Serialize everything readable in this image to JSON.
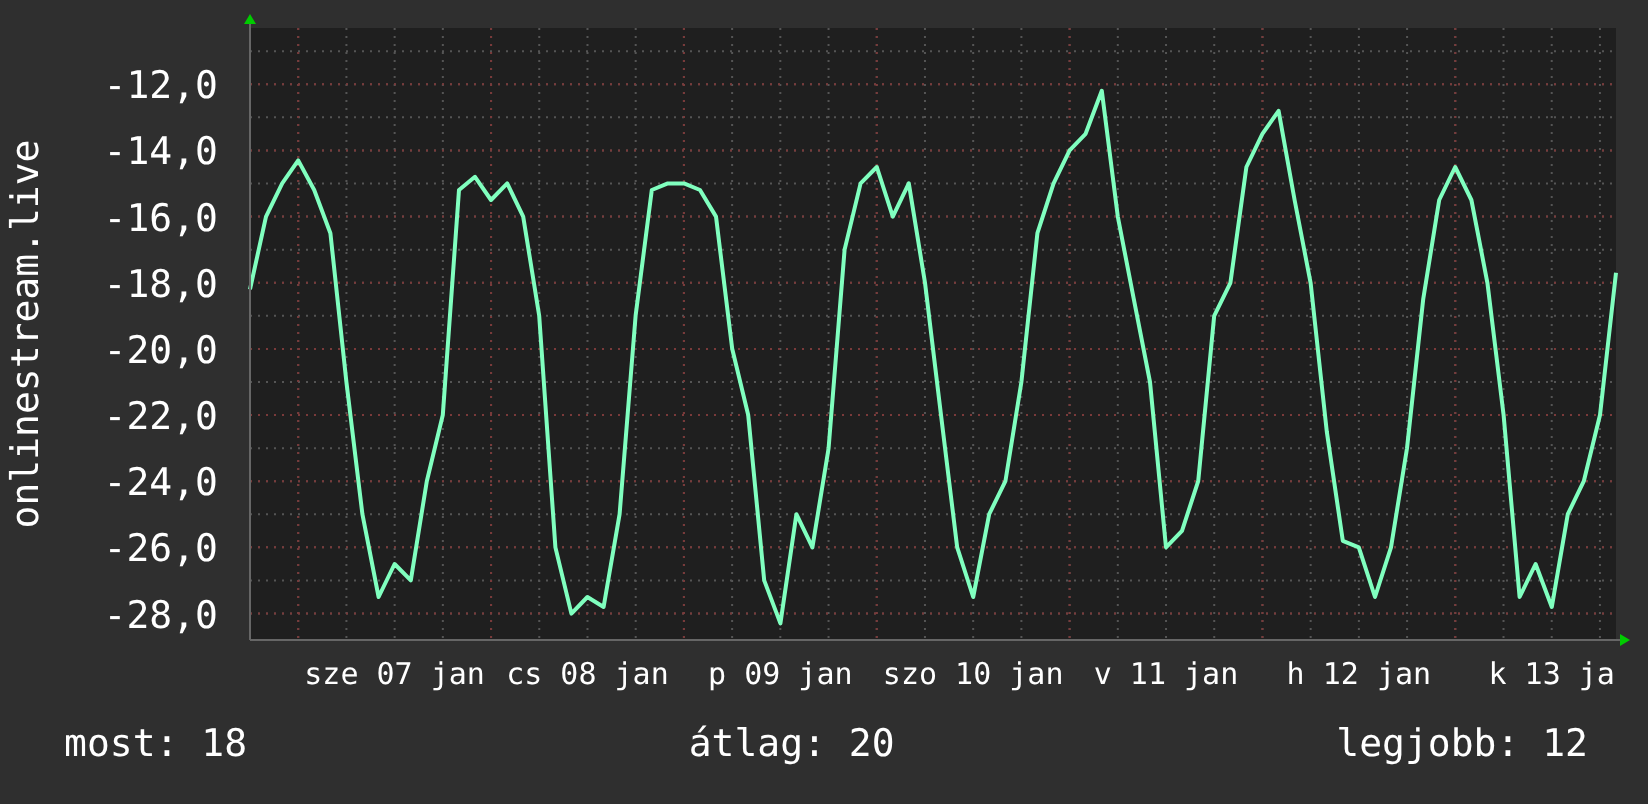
{
  "chart": {
    "chart_data": {
      "type": "line",
      "ylabel": "onlinestream.live",
      "categories": [
        null,
        null,
        null,
        null,
        null,
        null,
        null,
        null,
        null,
        "sze 07 jan",
        null,
        null,
        null,
        null,
        null,
        null,
        null,
        null,
        null,
        null,
        null,
        "cs 08 jan",
        null,
        null,
        null,
        null,
        null,
        null,
        null,
        null,
        null,
        null,
        null,
        "p 09 jan",
        null,
        null,
        null,
        null,
        null,
        null,
        null,
        null,
        null,
        null,
        null,
        "szo 10 jan",
        null,
        null,
        null,
        null,
        null,
        null,
        null,
        null,
        null,
        null,
        null,
        "v 11 jan",
        null,
        null,
        null,
        null,
        null,
        null,
        null,
        null,
        null,
        null,
        null,
        "h 12 jan",
        null,
        null,
        null,
        null,
        null,
        null,
        null,
        null,
        null,
        null,
        null,
        "k 13 ja",
        null,
        null,
        null,
        null
      ],
      "series": [
        {
          "color": "#80ffbf",
          "values": [
            -18.2,
            -16,
            -15,
            -14.3,
            -15.2,
            -16.5,
            -21,
            -25,
            -27.5,
            -26.5,
            -27,
            -24,
            -22,
            -15.2,
            -14.8,
            -15.5,
            -15,
            -16,
            -19,
            -26,
            -28,
            -27.5,
            -27.8,
            -25,
            -19,
            -15.2,
            -15,
            -15,
            -15.2,
            -16,
            -20,
            -22,
            -27,
            -28.3,
            -25,
            -26,
            -23,
            -17,
            -15,
            -14.5,
            -16,
            -15,
            -18,
            -22,
            -26,
            -27.5,
            -25,
            -24,
            -21,
            -16.5,
            -15,
            -14,
            -13.5,
            -12.2,
            -16,
            -18.5,
            -21,
            -26,
            -25.5,
            -24,
            -19,
            -18,
            -14.5,
            -13.5,
            -12.8,
            -15.5,
            -18,
            -22.5,
            -25.8,
            -26,
            -27.5,
            -26,
            -23,
            -18.5,
            -15.5,
            -14.5,
            -15.5,
            -18,
            -22,
            -27.5,
            -26.5,
            -27.8,
            -25,
            -24,
            -22,
            -17.7
          ]
        }
      ],
      "ylim": [
        -28.8,
        -10.3
      ],
      "grid": true,
      "yticks": [
        {
          "value": -12,
          "label": "-12,0"
        },
        {
          "value": -14,
          "label": "-14,0"
        },
        {
          "value": -16,
          "label": "-16,0"
        },
        {
          "value": -18,
          "label": "-18,0"
        },
        {
          "value": -20,
          "label": "-20,0"
        },
        {
          "value": -22,
          "label": "-22,0"
        },
        {
          "value": -24,
          "label": "-24,0"
        },
        {
          "value": -26,
          "label": "-26,0"
        },
        {
          "value": -28,
          "label": "-28,0"
        }
      ]
    }
  },
  "stats": [
    "most: 18",
    "átlag: 20",
    "legjobb: 12"
  ]
}
